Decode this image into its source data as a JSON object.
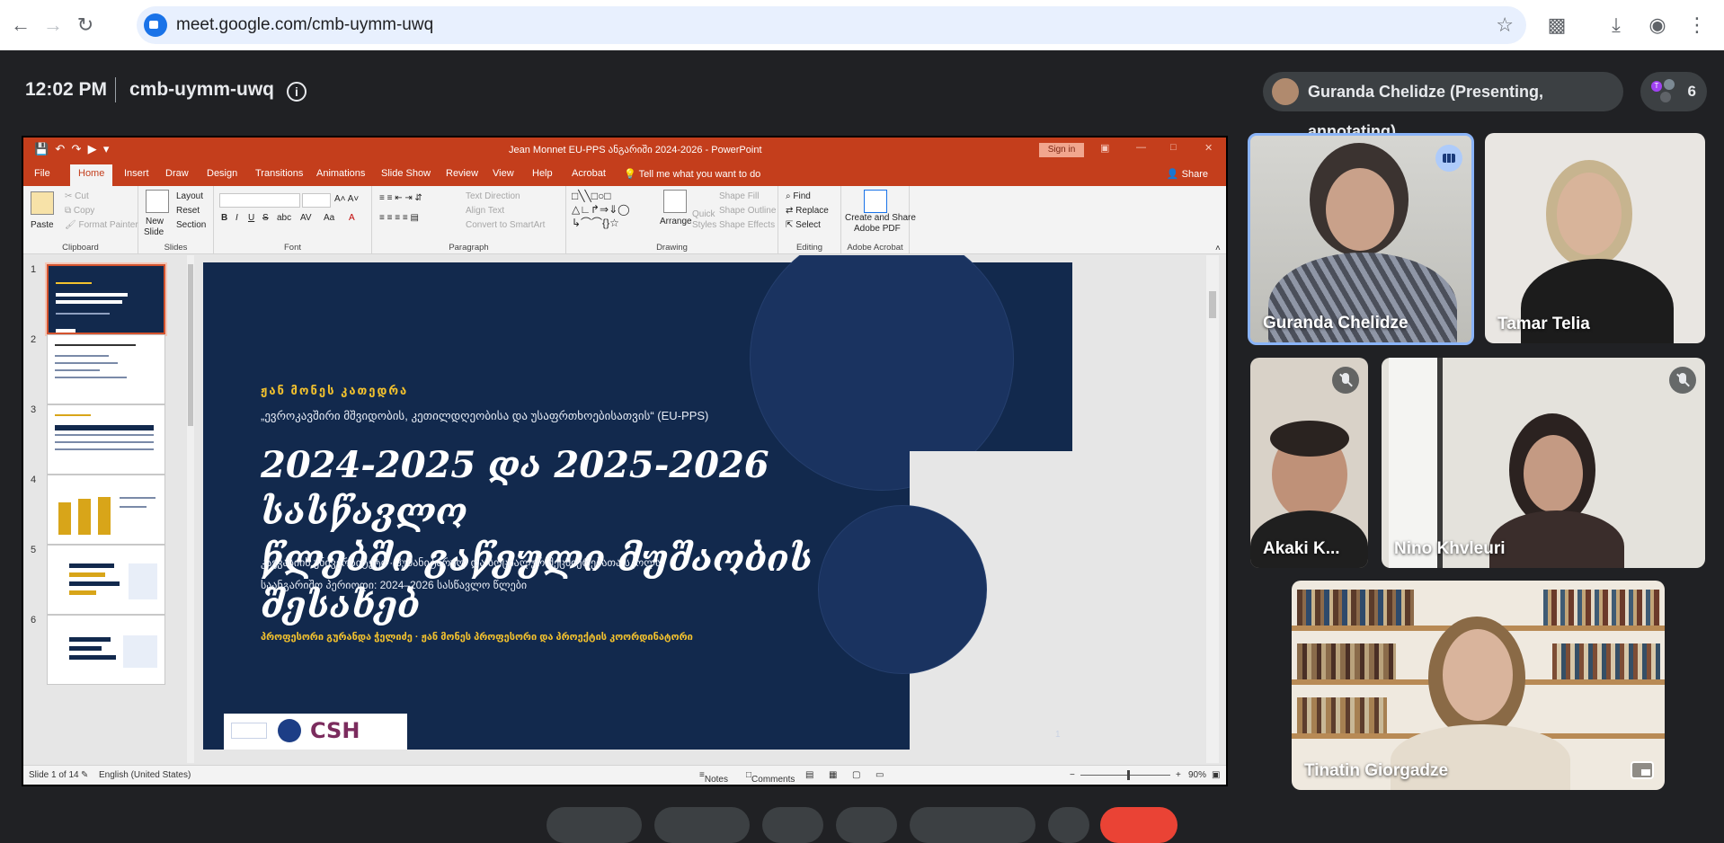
{
  "browser": {
    "url": "meet.google.com/cmb-uymm-uwq"
  },
  "meet": {
    "time": "12:02 PM",
    "meeting_code": "cmb-uymm-uwq",
    "presenter_status": "Guranda Chelidze (Presenting, annotating)",
    "participant_count": "6",
    "participant_initial": "T"
  },
  "ppt": {
    "doc_title": "Jean Monnet EU-PPS ანგარიში 2024-2026  -  PowerPoint",
    "sign_in": "Sign in",
    "tabs": [
      "File",
      "Home",
      "Insert",
      "Draw",
      "Design",
      "Transitions",
      "Animations",
      "Slide Show",
      "Review",
      "View",
      "Help",
      "Acrobat"
    ],
    "tell_me": "Tell me what you want to do",
    "share": "Share",
    "ribbon": {
      "clipboard": {
        "paste": "Paste",
        "cut": "Cut",
        "copy": "Copy",
        "format_painter": "Format Painter",
        "label": "Clipboard"
      },
      "slides": {
        "new_slide_1": "New",
        "new_slide_2": "Slide",
        "layout": "Layout",
        "reset": "Reset",
        "section": "Section",
        "label": "Slides"
      },
      "font": {
        "bold": "B",
        "italic": "I",
        "underline": "U",
        "strike": "S",
        "shadow": "abc",
        "spacing": "AV",
        "case": "Aa",
        "color": "A",
        "label": "Font"
      },
      "paragraph": {
        "text_direction": "Text Direction",
        "align_text": "Align Text",
        "smartart": "Convert to SmartArt",
        "label": "Paragraph"
      },
      "drawing": {
        "arrange": "Arrange",
        "quick_styles_1": "Quick",
        "quick_styles_2": "Styles",
        "shape_fill": "Shape Fill",
        "shape_outline": "Shape Outline",
        "shape_effects": "Shape Effects",
        "label": "Drawing"
      },
      "editing": {
        "find": "Find",
        "replace": "Replace",
        "select": "Select",
        "label": "Editing"
      },
      "acrobat": {
        "create_1": "Create and Share",
        "create_2": "Adobe PDF",
        "label": "Adobe Acrobat"
      }
    },
    "thumbnails": [
      "1",
      "2",
      "3",
      "4",
      "5",
      "6"
    ],
    "slide": {
      "label": "ჟან მონეს კათედრა",
      "subtitle": "„ევროკავშირი მშვიდობის, კეთილდღეობისა და უსაფრთხოებისათვის“ (EU-PPS)",
      "title_line1": "2024-2025 და 2025-2026 სასწავლო",
      "title_line2": "წლებში გაწეული მუშაობის შესახებ",
      "line1": "კავკასიის უნივერსიტეტი  ·  ჰუმანიტარულ და სოციალურ მეცნიერებათა სკოლა",
      "line2": "საანგარიშო პერიოდი: 2024–2026 სასწავლო წლები",
      "author": "პროფესორი გურანდა ჭელიძე  ·  ჟან მონეს პროფესორი და პროექტის კოორდინატორი",
      "logo_text": "CSH",
      "number": "1"
    },
    "status": {
      "slide_of": "Slide 1 of 14",
      "language": "English (United States)",
      "notes": "Notes",
      "comments": "Comments",
      "zoom": "90%"
    }
  },
  "participants": [
    {
      "name": "Guranda Chelidze",
      "state": "speaking"
    },
    {
      "name": "Tamar Telia",
      "state": "unmuted"
    },
    {
      "name": "Akaki K...",
      "state": "muted"
    },
    {
      "name": "Nino Khvleuri",
      "state": "muted"
    },
    {
      "name": "Tinatin Giorgadze",
      "state": "self"
    }
  ],
  "colors": {
    "ppt_accent": "#c43e1c",
    "slide_bg": "#12294d",
    "slide_gold": "#f2c12e",
    "meet_bg": "#202124",
    "speaking_border": "#8ab4f8"
  }
}
